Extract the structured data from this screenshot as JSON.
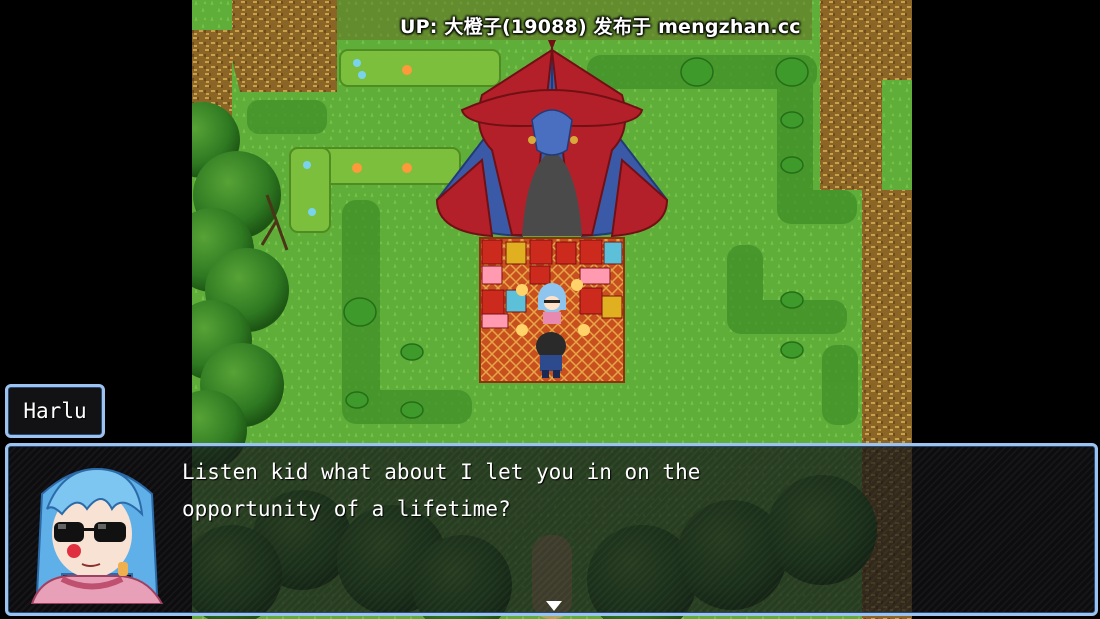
{
  "watermark": {
    "text": "UP: 大橙子(19088) 发布于 mengzhan.cc"
  },
  "dialog": {
    "speaker": "Harlu",
    "lines": [
      "Listen kid what about I let you in on the",
      "opportunity of a lifetime?"
    ]
  },
  "colors": {
    "window_border": "#9cc3ef",
    "grass": "#5fae3a",
    "tent_red": "#b4202a",
    "tent_blue": "#3a5aa8"
  }
}
